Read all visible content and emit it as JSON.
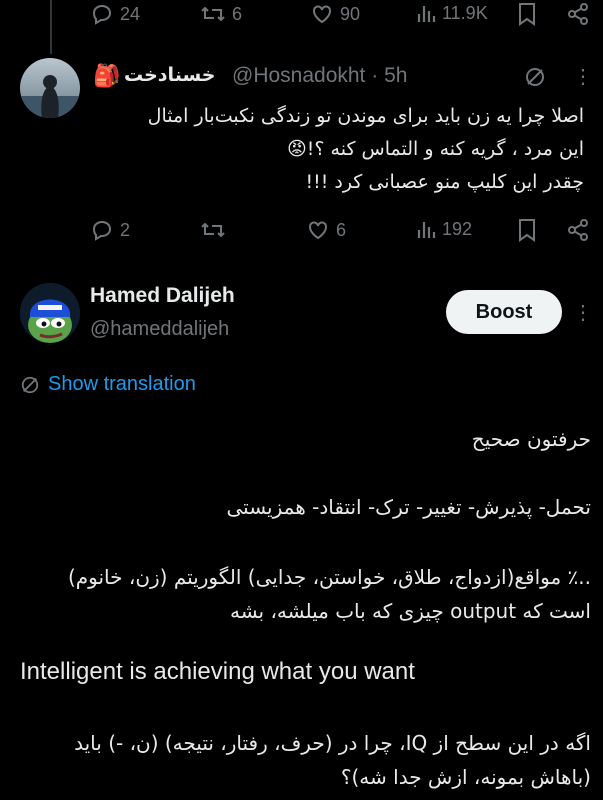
{
  "parent_actions": {
    "replies": "24",
    "reposts": "6",
    "likes": "90",
    "views": "11.9K"
  },
  "reply_tweet": {
    "display_name": "خسنادخت",
    "handle": "@Hosnadokht",
    "separator": "·",
    "time": "5h",
    "lines": [
      "اصلا چرا یه زن باید برای موندن تو زندگی نکبت‌بار امثال",
      "این مرد ، گریه کنه و التماس کنه ؟!😡",
      "چقدر این کلیپ منو عصبانی کرد !!!"
    ],
    "actions": {
      "replies": "2",
      "reposts": "",
      "likes": "6",
      "views": "192"
    }
  },
  "main_tweet": {
    "display_name": "Hamed Dalijeh",
    "handle": "@hameddalijeh",
    "boost_label": "Boost",
    "show_translation": "Show translation",
    "paragraphs": [
      "حرفتون صحیح",
      "تحمل- پذیرش- تغییر- ترک- انتقاد- همزیستی",
      "..٪ مواقع(ازدواج، طلاق، خواستن، جدایی) الگوریتم (زن، خانوم) است که output چیزی که باب میلشه، بشه",
      "Intelligent is achieving what you want",
      "اگه در این سطح از IQ، چرا در (حرف، رفتار، نتیجه) (ن، -) باید (باهاش بمونه، ازش جدا شه)؟"
    ]
  },
  "colors": {
    "background": "#000000",
    "text": "#e7e9ea",
    "muted": "#71767b",
    "link": "#1d9bf0",
    "button_bg": "#eff3f4"
  },
  "icons": [
    "reply-icon",
    "repost-icon",
    "like-icon",
    "views-icon",
    "bookmark-icon",
    "share-icon",
    "grok-icon",
    "more-icon",
    "translate-icon",
    "bag-emoji-icon",
    "angry-emoji-icon"
  ]
}
